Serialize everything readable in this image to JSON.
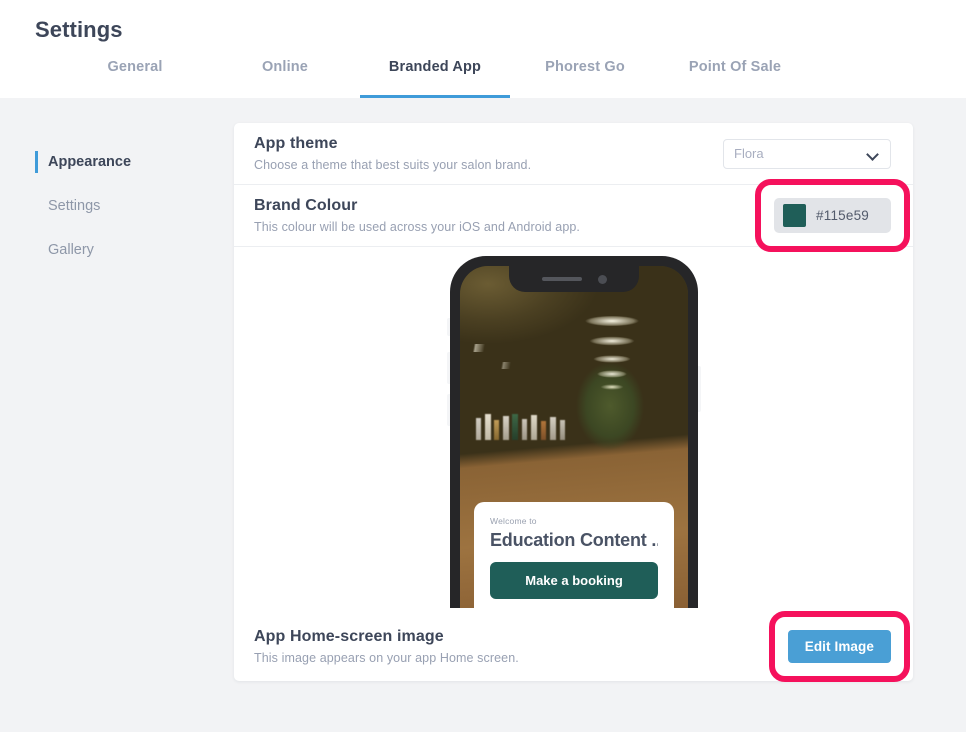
{
  "header": {
    "title": "Settings",
    "tabs": [
      {
        "label": "General",
        "active": false
      },
      {
        "label": "Online",
        "active": false
      },
      {
        "label": "Branded App",
        "active": true
      },
      {
        "label": "Phorest Go",
        "active": false
      },
      {
        "label": "Point Of Sale",
        "active": false
      }
    ]
  },
  "sidebar": {
    "items": [
      {
        "label": "Appearance",
        "active": true
      },
      {
        "label": "Settings",
        "active": false
      },
      {
        "label": "Gallery",
        "active": false
      }
    ]
  },
  "main": {
    "app_theme": {
      "title": "App theme",
      "subtitle": "Choose a theme that best suits your salon brand.",
      "selected": "Flora",
      "options": [
        "Flora"
      ]
    },
    "brand_colour": {
      "title": "Brand Colour",
      "subtitle": "This colour will be used across your iOS and Android app.",
      "hex": "#115e59",
      "swatch_color": "#1f5e58"
    },
    "home_image": {
      "title": "App Home-screen image",
      "subtitle": "This image appears on your app Home screen.",
      "button_label": "Edit Image"
    }
  },
  "phone_preview": {
    "welcome_kicker": "Welcome to",
    "welcome_title": "Education Content ...",
    "booking_button": "Make a booking"
  },
  "colors": {
    "accent_blue": "#4a9fd5",
    "tab_underline": "#3f9bd9",
    "highlight_ring": "#f5115c",
    "brand_teal": "#1f5e58",
    "page_background": "#f2f3f5"
  }
}
